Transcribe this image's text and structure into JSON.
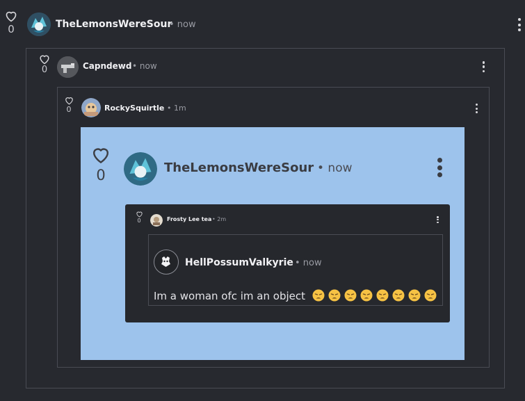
{
  "thread": {
    "comment1": {
      "username": "TheLemonsWereSour",
      "time": "• now",
      "likes": "0",
      "avatar": "vaporeon-avatar"
    },
    "comment2": {
      "username": "Capndewd",
      "time": "• now",
      "likes": "0",
      "avatar": "gun-avatar"
    },
    "comment3": {
      "username": "RockySquirtle",
      "time": "• 1m",
      "likes": "0",
      "avatar": "squirtle-avatar"
    }
  },
  "screenshot": {
    "background_color": "#9dc3ec",
    "comment": {
      "username": "TheLemonsWereSour",
      "time": "• now",
      "likes": "0"
    },
    "nested": {
      "username": "Frosty Lee tea",
      "time": "• 2m",
      "likes": "0",
      "quote": {
        "username": "HellPossumValkyrie",
        "time": "• now",
        "text": "Im a woman ofc im an object",
        "emojis": [
          "😩",
          "😩",
          "😩",
          "😩",
          "😩",
          "😩",
          "😩",
          "😩"
        ]
      }
    }
  },
  "icons": {
    "like": "heart-outline-icon",
    "menu": "more-vertical-icon"
  }
}
